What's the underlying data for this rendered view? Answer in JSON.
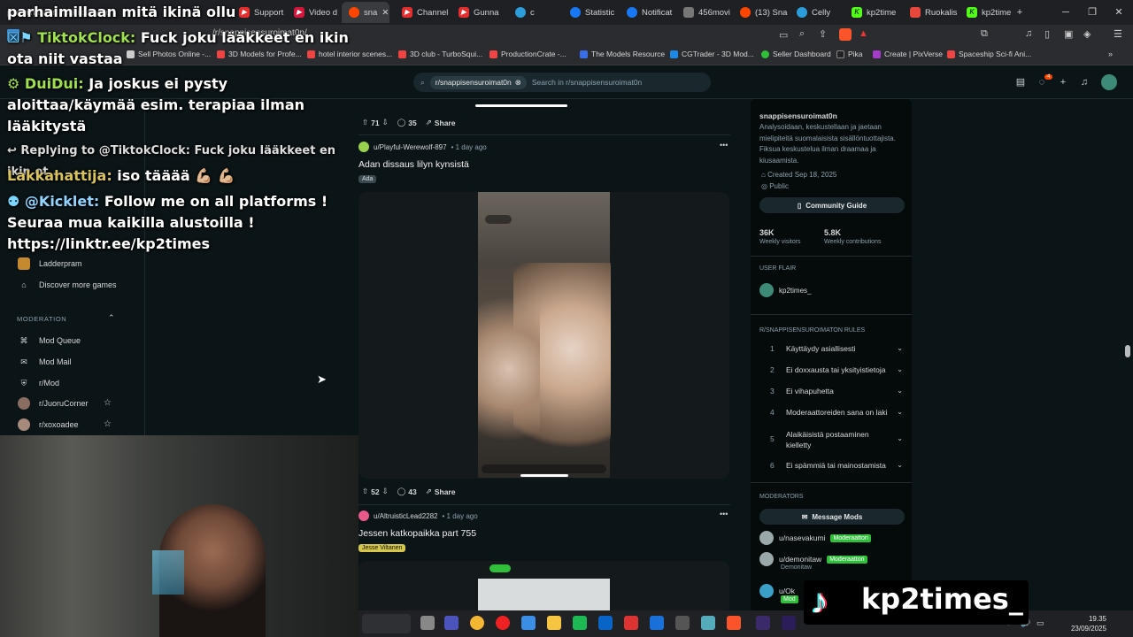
{
  "browser": {
    "tabs": [
      {
        "label": "parhaimillaan mitä ikinä ollu",
        "color": "#e52e2e"
      },
      {
        "label": "Support",
        "color": "#e52e2e"
      },
      {
        "label": "Video d",
        "color": "#d5173e"
      },
      {
        "label": "sna",
        "color": "#ff4500"
      },
      {
        "label": "Channel",
        "color": "#e52e2e"
      },
      {
        "label": "Gunna",
        "color": "#e52e2e"
      },
      {
        "label": "c",
        "color": "#2d9cdb"
      },
      {
        "label": "Statistic",
        "color": "#1877f2"
      },
      {
        "label": "Notificat",
        "color": "#1877f2"
      },
      {
        "label": "456movi",
        "color": "#777777"
      },
      {
        "label": "(13) Sna",
        "color": "#ff4500"
      },
      {
        "label": "Celly",
        "color": "#2d9cdb"
      },
      {
        "label": "kp2time",
        "color": "#53fc18"
      },
      {
        "label": "Ruokalis",
        "color": "#e7483b"
      },
      {
        "label": "kp2time",
        "color": "#53fc18"
      }
    ],
    "new_tab": "+",
    "url": "/r/snappisensuroimat0n/",
    "bookmarks": [
      "Sell Photos Online -...",
      "3D Models for Profe...",
      "hotel interior scenes...",
      "3D club - TurboSqui...",
      "ProductionCrate -...",
      "The Models Resource",
      "CGTrader - 3D Mod...",
      "Seller Dashboard",
      "Pika",
      "Create | PixVerse",
      "Spaceship Sci-fi Ani..."
    ]
  },
  "reddit": {
    "search_chip": "r/snappisensuroimat0n",
    "search_placeholder": "Search in r/snappisensuroimat0n",
    "notif_count": "4"
  },
  "leftnav": {
    "items": [
      "Ladderpram",
      "Discover more games"
    ],
    "moderation_header": "MODERATION",
    "mod_items": [
      "Mod Queue",
      "Mod Mail",
      "r/Mod",
      "r/JuoruCorner",
      "r/xoxoadee"
    ]
  },
  "chat_overlay": [
    {
      "name": "",
      "text": "parhaimillaan mitä ikinä ollu"
    },
    {
      "name": "TiktokClock:",
      "text": "Fuck joku lääkkeet en ikin ota niit vastaa"
    },
    {
      "name": "DuiDui:",
      "text": "Ja joskus ei pysty aloittaa/käymää esim. terapiaa ilman lääkitystä"
    },
    {
      "name": "",
      "text": "Replying to @TiktokClock: Fuck joku lääkkeet en ikin ot..."
    },
    {
      "name": "Lakkahattija:",
      "text": "iso tääää 💪🏼 💪🏼"
    },
    {
      "name": "@Kicklet:",
      "text": "Follow me on all platforms ! Seuraa mua kaikilla alustoilla ! https://linktr.ee/kp2times"
    }
  ],
  "feed": {
    "post0_actions": {
      "votes": "71",
      "comments": "35",
      "share": "Share"
    },
    "post1": {
      "author": "u/Playful-Werewolf-897",
      "time": "• 1 day ago",
      "title": "Adan dissaus lilyn kynsistä",
      "flair": "Ada",
      "votes": "52",
      "comments": "43",
      "share": "Share"
    },
    "post2": {
      "author": "u/AltruisticLead2282",
      "time": "• 1 day ago",
      "title": "Jessen katkopaikka part 755",
      "flair": "Jesse Viltanen"
    },
    "more": "•••"
  },
  "sidebar": {
    "name": "snappisensuroimat0n",
    "desc": "Analysoidaan, keskustellaan ja jaetaan mielipiteitä suomalaisista sisällöntuottajista. Fiksua keskustelua ilman draamaa ja kiusaamista.",
    "created": "Created Sep 18, 2025",
    "visibility": "Public",
    "guide": "Community Guide",
    "visitors": "36K",
    "visitors_label": "Weekly visitors",
    "contrib": "5.8K",
    "contrib_label": "Weekly contributions",
    "user_flair_h": "USER FLAIR",
    "user_flair": "kp2times_",
    "rules_h": "R/SNAPPISENSUROIMATON RULES",
    "rules": [
      {
        "n": "1",
        "t": "Käyttäydy asiallisesti"
      },
      {
        "n": "2",
        "t": "Ei doxxausta tai yksityistietoja"
      },
      {
        "n": "3",
        "t": "Ei vihapuhetta"
      },
      {
        "n": "4",
        "t": "Moderaattoreiden sana on laki"
      },
      {
        "n": "5",
        "t": "Alaikäisistä postaaminen kielletty"
      },
      {
        "n": "6",
        "t": "Ei spämmiä tai mainostamista"
      }
    ],
    "mods_h": "MODERATORS",
    "message_mods": "Message Mods",
    "mods": [
      {
        "name": "u/nasevakumi",
        "flair": "Moderaattori",
        "sub": ""
      },
      {
        "name": "u/demonitaw",
        "flair": "Moderaattori",
        "sub": "Demonitaw"
      },
      {
        "name": "u/Ok",
        "flair": "Mod",
        "sub": ""
      }
    ]
  },
  "system": {
    "time": "19.35",
    "date": "23/09/2025"
  },
  "stream_brand": "kp2times_"
}
